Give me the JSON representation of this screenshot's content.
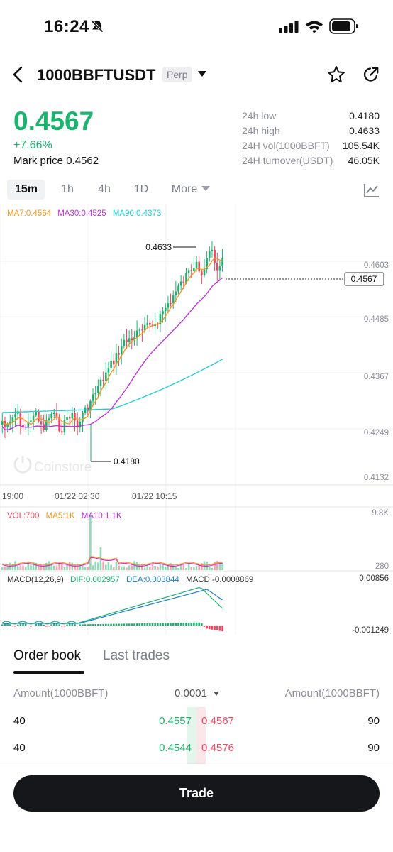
{
  "status_bar": {
    "time": "16:24"
  },
  "header": {
    "pair": "1000BBFTUSDT",
    "badge": "Perp"
  },
  "price": {
    "last": "0.4567",
    "change": "+7.66%",
    "mark_label": "Mark price",
    "mark_value": "0.4562"
  },
  "stats": [
    {
      "label": "24h low",
      "value": "0.4180"
    },
    {
      "label": "24h high",
      "value": "0.4633"
    },
    {
      "label": "24H vol(1000BBFT)",
      "value": "105.54K"
    },
    {
      "label": "24H turnover(USDT)",
      "value": "46.05K"
    }
  ],
  "intervals": [
    {
      "label": "15m",
      "active": true
    },
    {
      "label": "1h",
      "active": false
    },
    {
      "label": "4h",
      "active": false
    },
    {
      "label": "1D",
      "active": false
    },
    {
      "label": "More",
      "active": false
    }
  ],
  "chart": {
    "ma_legend": [
      {
        "text": "MA7:0.4564",
        "color": "#f7931a"
      },
      {
        "text": "MA30:0.4525",
        "color": "#c12ee0"
      },
      {
        "text": "MA90:0.4373",
        "color": "#1ccfd6"
      }
    ],
    "price_ticks": [
      "0.4603",
      "0.4485",
      "0.4367",
      "0.4249",
      "0.4132"
    ],
    "time_ticks": [
      "19:00",
      "01/22 02:30",
      "01/22 10:15"
    ],
    "high_label": "0.4633",
    "low_label": "0.4180",
    "current_label": "0.4567",
    "watermark": "Coinstore",
    "vol_legend": [
      {
        "text": "VOL:700",
        "color": "#f0465e"
      },
      {
        "text": "MA5:1K",
        "color": "#f7931a"
      },
      {
        "text": "MA10:1.1K",
        "color": "#c12ee0"
      }
    ],
    "vol_ticks": [
      "9.8K",
      "280"
    ],
    "macd_legend": [
      {
        "text": "MACD(12,26,9)",
        "color": "#333333"
      },
      {
        "text": "DIF:0.002957",
        "color": "#1cb36f"
      },
      {
        "text": "DEA:0.003844",
        "color": "#1e7fd6"
      },
      {
        "text": "MACD:-0.0008869",
        "color": "#333333"
      }
    ],
    "macd_ticks": [
      "0.00856",
      "-0.001249"
    ],
    "colors": {
      "up": "#1cb36f",
      "down": "#f0465e",
      "ma7": "#f7931a",
      "ma30": "#c12ee0",
      "ma90": "#1ccfd6",
      "dea": "#1e7fd6"
    }
  },
  "order_book": {
    "tabs": [
      "Order book",
      "Last trades"
    ],
    "head_left": "Amount(1000BBFT)",
    "head_mid": "0.0001",
    "head_right": "Amount(1000BBFT)",
    "rows": [
      {
        "bid_amount": "40",
        "bid_price": "0.4557",
        "ask_price": "0.4567",
        "ask_amount": "90"
      },
      {
        "bid_amount": "40",
        "bid_price": "0.4544",
        "ask_price": "0.4576",
        "ask_amount": "90"
      }
    ]
  },
  "trade_button": "Trade"
}
